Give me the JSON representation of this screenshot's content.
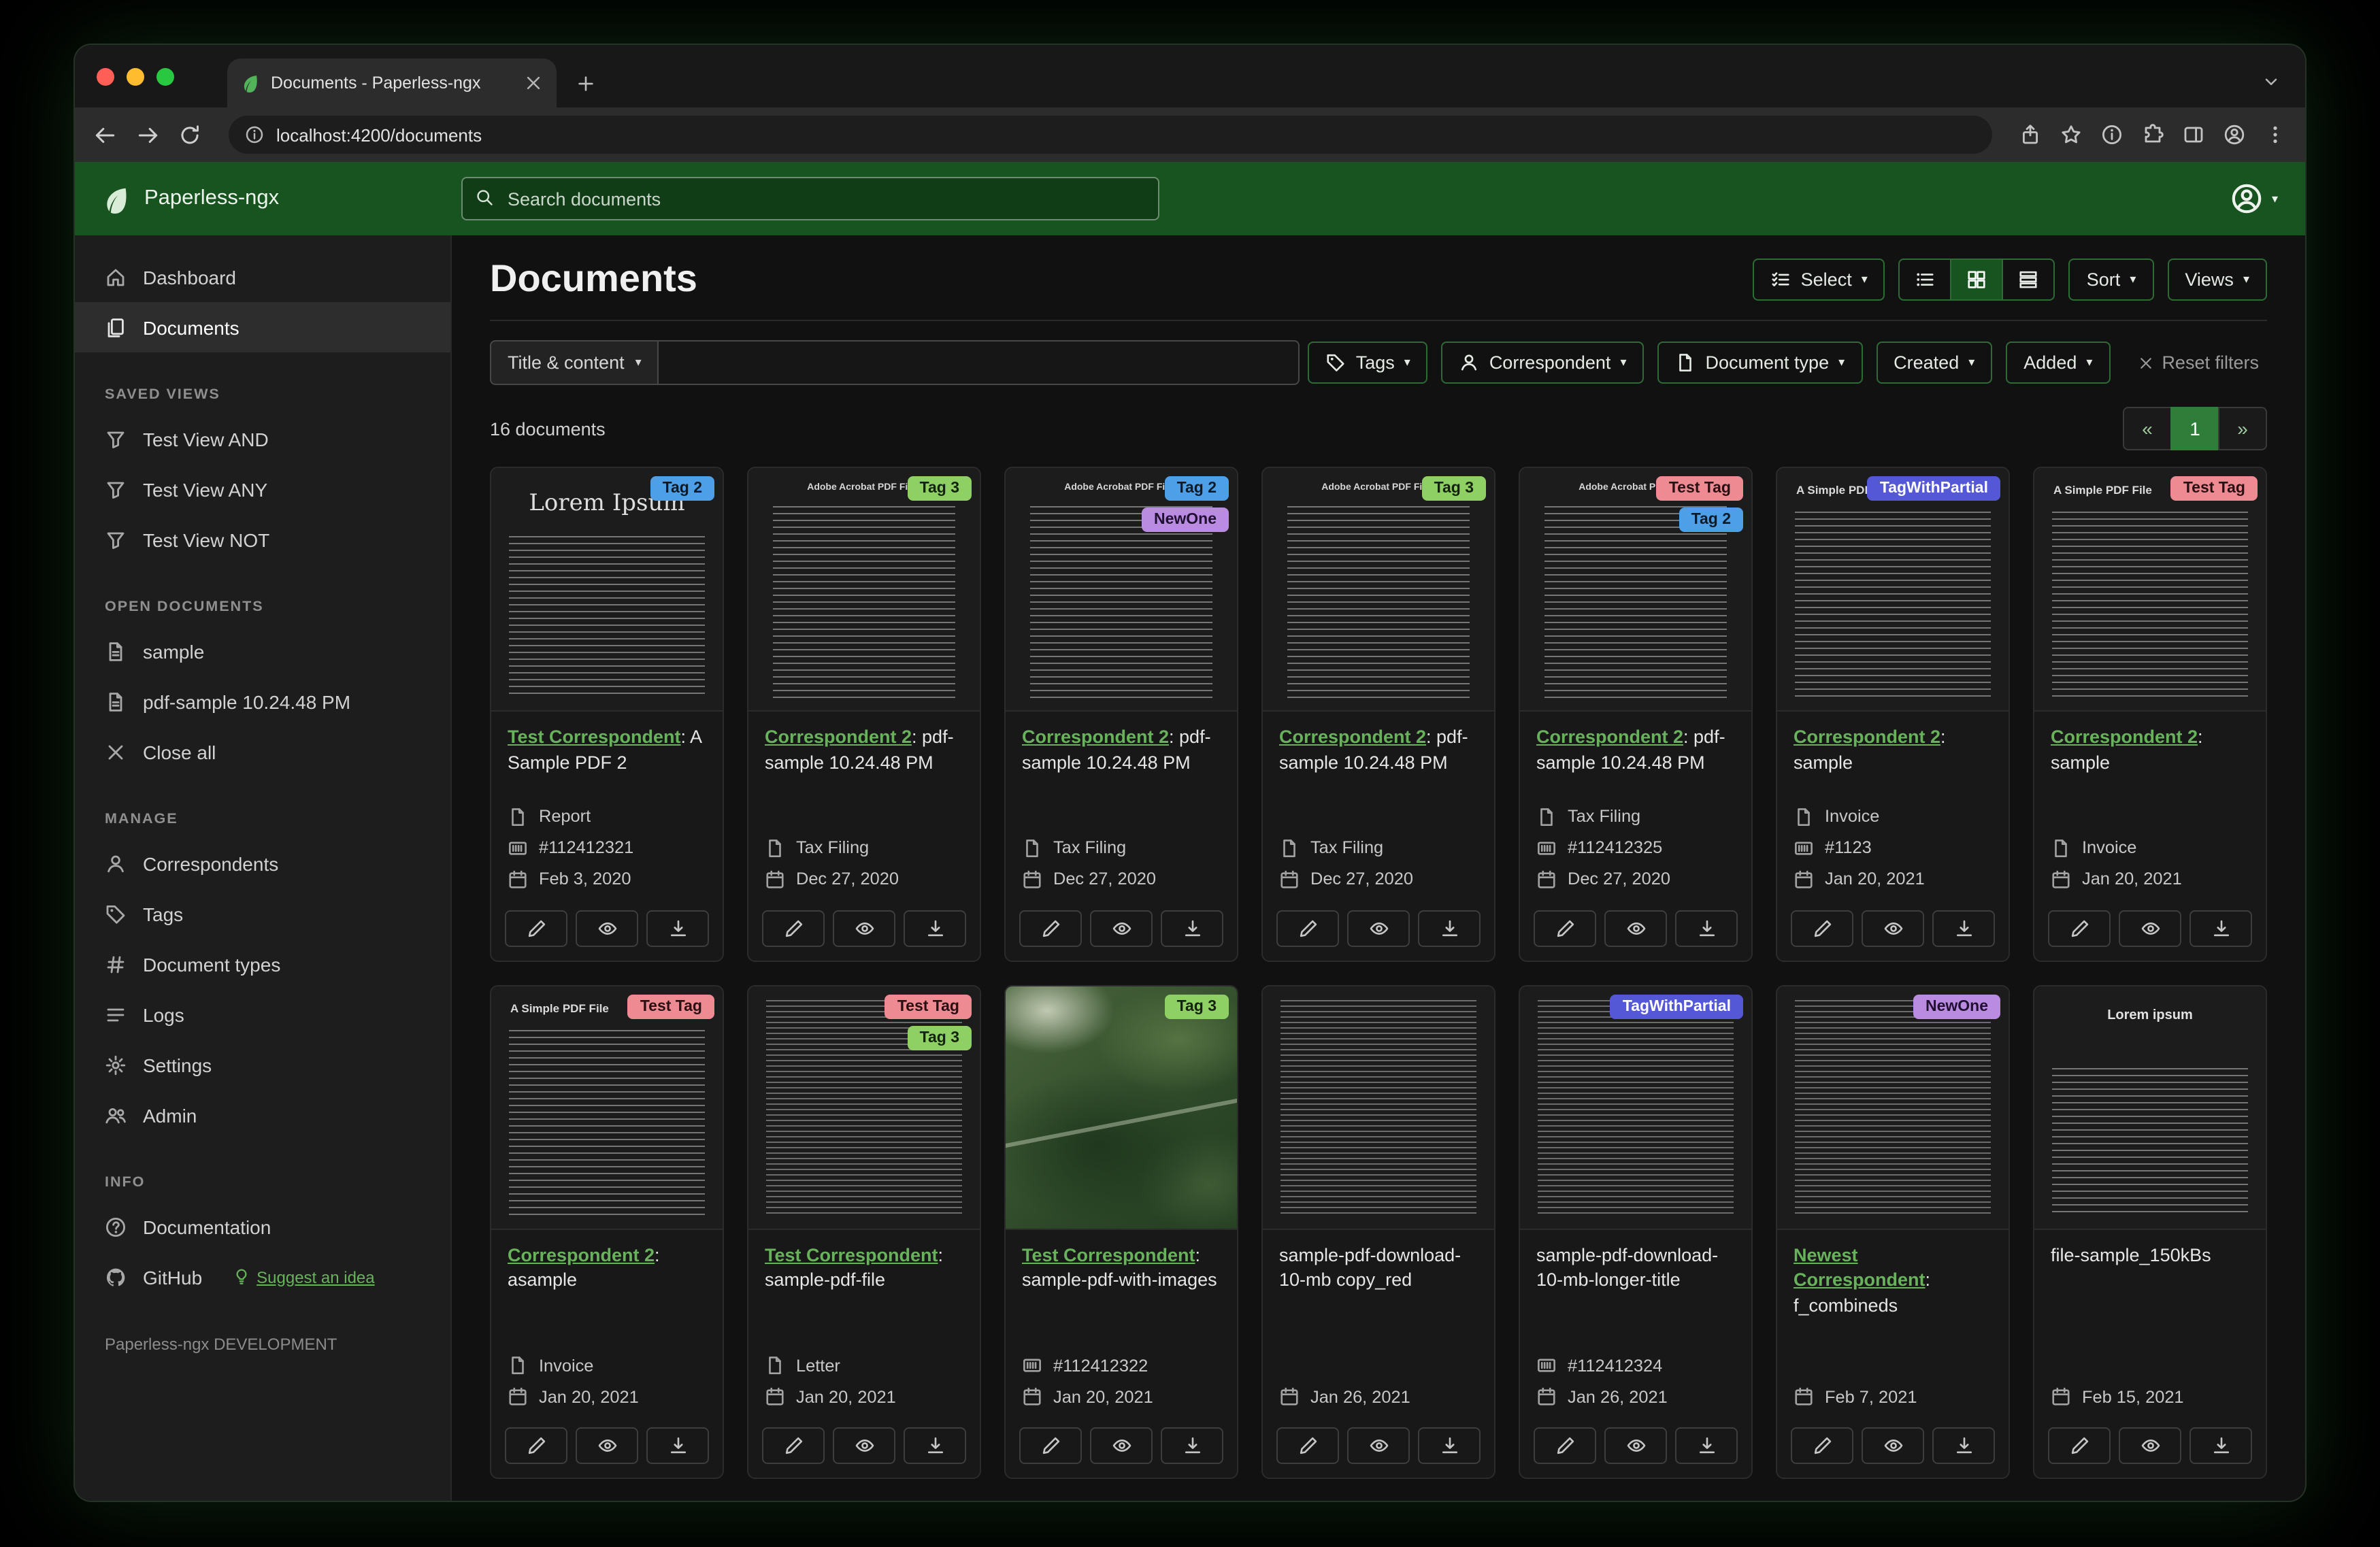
{
  "browser": {
    "tab_title": "Documents - Paperless-ngx",
    "url": "localhost:4200/documents"
  },
  "header": {
    "app_name": "Paperless-ngx",
    "search_placeholder": "Search documents"
  },
  "colors": {
    "header_green": "#17541f",
    "link_green": "#68b25c",
    "active_page_green": "#2f7d38",
    "tag_blue": "#4da0e8",
    "tag_green": "#8fd065",
    "tag_purple": "#b98ce2",
    "tag_pink": "#ee8a92",
    "tag_indigo": "#5558d6"
  },
  "sidebar": {
    "primary": [
      {
        "label": "Dashboard",
        "icon": "house-icon",
        "active": false
      },
      {
        "label": "Documents",
        "icon": "documents-icon",
        "active": true
      }
    ],
    "sections": [
      {
        "heading": "SAVED VIEWS",
        "items": [
          {
            "label": "Test View AND",
            "icon": "funnel-icon"
          },
          {
            "label": "Test View ANY",
            "icon": "funnel-icon"
          },
          {
            "label": "Test View NOT",
            "icon": "funnel-icon"
          }
        ]
      },
      {
        "heading": "OPEN DOCUMENTS",
        "items": [
          {
            "label": "sample",
            "icon": "file-text-icon"
          },
          {
            "label": "pdf-sample 10.24.48 PM",
            "icon": "file-text-icon"
          },
          {
            "label": "Close all",
            "icon": "close-icon"
          }
        ]
      },
      {
        "heading": "MANAGE",
        "items": [
          {
            "label": "Correspondents",
            "icon": "person-icon"
          },
          {
            "label": "Tags",
            "icon": "tag-icon"
          },
          {
            "label": "Document types",
            "icon": "hash-icon"
          },
          {
            "label": "Logs",
            "icon": "list-icon"
          },
          {
            "label": "Settings",
            "icon": "gear-icon"
          },
          {
            "label": "Admin",
            "icon": "people-icon"
          }
        ]
      },
      {
        "heading": "INFO",
        "items": [
          {
            "label": "Documentation",
            "icon": "question-circle-icon"
          },
          {
            "label": "GitHub",
            "icon": "github-icon",
            "extra": {
              "label": "Suggest an idea",
              "icon": "lightbulb-icon"
            }
          }
        ]
      }
    ],
    "footer": "Paperless-ngx DEVELOPMENT"
  },
  "main": {
    "title": "Documents",
    "count_text": "16 documents",
    "toolbar": {
      "select_label": "Select",
      "sort_label": "Sort",
      "views_label": "Views",
      "view_modes": [
        {
          "icon": "view-list-icon",
          "active": false
        },
        {
          "icon": "view-grid-icon",
          "active": true
        },
        {
          "icon": "view-details-icon",
          "active": false
        }
      ]
    },
    "filters": {
      "text_filter_label": "Title & content",
      "text_filter_value": "",
      "buttons": [
        {
          "label": "Tags",
          "icon": "tag-icon"
        },
        {
          "label": "Correspondent",
          "icon": "person-icon"
        },
        {
          "label": "Document type",
          "icon": "file-icon"
        },
        {
          "label": "Created",
          "icon": ""
        },
        {
          "label": "Added",
          "icon": ""
        }
      ],
      "reset_label": "Reset filters"
    },
    "pagination": {
      "prev": "«",
      "page": "1",
      "next": "»"
    },
    "documents": [
      {
        "thumb": {
          "kind": "lorem",
          "heading": "Lorem Ipsum"
        },
        "tags": [
          {
            "label": "Tag 2",
            "bg": "#4da0e8",
            "fg": "#0d1b28"
          }
        ],
        "correspondent": "Test Correspondent",
        "title_suffix": ": A Sample PDF 2",
        "doc_type": "Report",
        "asn": "#112412321",
        "date": "Feb 3, 2020"
      },
      {
        "thumb": {
          "kind": "acrobat",
          "heading": "Adobe Acrobat PDF Files"
        },
        "tags": [
          {
            "label": "Tag 3",
            "bg": "#8fd065",
            "fg": "#14230d"
          }
        ],
        "correspondent": "Correspondent 2",
        "title_suffix": ": pdf-sample 10.24.48 PM",
        "doc_type": "Tax Filing",
        "asn": null,
        "date": "Dec 27, 2020"
      },
      {
        "thumb": {
          "kind": "acrobat",
          "heading": "Adobe Acrobat PDF Files"
        },
        "tags": [
          {
            "label": "Tag 2",
            "bg": "#4da0e8",
            "fg": "#0d1b28"
          },
          {
            "label": "NewOne",
            "bg": "#b98ce2",
            "fg": "#201031"
          }
        ],
        "correspondent": "Correspondent 2",
        "title_suffix": ": pdf-sample 10.24.48 PM",
        "doc_type": "Tax Filing",
        "asn": null,
        "date": "Dec 27, 2020"
      },
      {
        "thumb": {
          "kind": "acrobat",
          "heading": "Adobe Acrobat PDF Files"
        },
        "tags": [
          {
            "label": "Tag 3",
            "bg": "#8fd065",
            "fg": "#14230d"
          }
        ],
        "correspondent": "Correspondent 2",
        "title_suffix": ": pdf-sample 10.24.48 PM",
        "doc_type": "Tax Filing",
        "asn": null,
        "date": "Dec 27, 2020"
      },
      {
        "thumb": {
          "kind": "acrobat",
          "heading": "Adobe Acrobat PDF Files"
        },
        "tags": [
          {
            "label": "Test Tag",
            "bg": "#ee8a92",
            "fg": "#2a1012"
          },
          {
            "label": "Tag 2",
            "bg": "#4da0e8",
            "fg": "#0d1b28"
          }
        ],
        "correspondent": "Correspondent 2",
        "title_suffix": ": pdf-sample 10.24.48 PM",
        "doc_type": "Tax Filing",
        "asn": "#112412325",
        "date": "Dec 27, 2020"
      },
      {
        "thumb": {
          "kind": "simple",
          "heading": "A Simple PDF File"
        },
        "tags": [
          {
            "label": "TagWithPartial",
            "bg": "#5558d6",
            "fg": "#ffffff"
          }
        ],
        "correspondent": "Correspondent 2",
        "title_suffix": ": sample",
        "doc_type": "Invoice",
        "asn": "#1123",
        "date": "Jan 20, 2021"
      },
      {
        "thumb": {
          "kind": "simple",
          "heading": "A Simple PDF File"
        },
        "tags": [
          {
            "label": "Test Tag",
            "bg": "#ee8a92",
            "fg": "#2a1012"
          }
        ],
        "correspondent": "Correspondent 2",
        "title_suffix": ": sample",
        "doc_type": "Invoice",
        "asn": null,
        "date": "Jan 20, 2021"
      },
      {
        "thumb": {
          "kind": "simple",
          "heading": "A Simple PDF File"
        },
        "tags": [
          {
            "label": "Test Tag",
            "bg": "#ee8a92",
            "fg": "#2a1012"
          }
        ],
        "correspondent": "Correspondent 2",
        "title_suffix": ": asample",
        "doc_type": "Invoice",
        "asn": null,
        "date": "Jan 20, 2021"
      },
      {
        "thumb": {
          "kind": "dense",
          "heading": ""
        },
        "tags": [
          {
            "label": "Test Tag",
            "bg": "#ee8a92",
            "fg": "#2a1012"
          },
          {
            "label": "Tag 3",
            "bg": "#8fd065",
            "fg": "#14230d"
          }
        ],
        "correspondent": "Test Correspondent",
        "title_suffix": ": sample-pdf-file",
        "doc_type": "Letter",
        "asn": null,
        "date": "Jan 20, 2021"
      },
      {
        "thumb": {
          "kind": "map",
          "heading": ""
        },
        "tags": [
          {
            "label": "Tag 3",
            "bg": "#8fd065",
            "fg": "#14230d"
          }
        ],
        "correspondent": "Test Correspondent",
        "title_suffix": ": sample-pdf-with-images",
        "doc_type": null,
        "asn": "#112412322",
        "date": "Jan 20, 2021"
      },
      {
        "thumb": {
          "kind": "dense",
          "heading": ""
        },
        "tags": [],
        "correspondent": null,
        "title_suffix": "sample-pdf-download-10-mb copy_red",
        "doc_type": null,
        "asn": null,
        "date": "Jan 26, 2021"
      },
      {
        "thumb": {
          "kind": "dense",
          "heading": ""
        },
        "tags": [
          {
            "label": "TagWithPartial",
            "bg": "#5558d6",
            "fg": "#ffffff"
          }
        ],
        "correspondent": null,
        "title_suffix": "sample-pdf-download-10-mb-longer-title",
        "doc_type": null,
        "asn": "#112412324",
        "date": "Jan 26, 2021"
      },
      {
        "thumb": {
          "kind": "dense",
          "heading": ""
        },
        "tags": [
          {
            "label": "NewOne",
            "bg": "#b98ce2",
            "fg": "#201031"
          }
        ],
        "correspondent": "Newest Correspondent",
        "title_suffix": ": f_combineds",
        "doc_type": null,
        "asn": null,
        "date": "Feb 7, 2021"
      },
      {
        "thumb": {
          "kind": "lorembold",
          "heading": "Lorem ipsum"
        },
        "tags": [],
        "correspondent": null,
        "title_suffix": "file-sample_150kBs",
        "doc_type": null,
        "asn": null,
        "date": "Feb 15, 2021"
      }
    ]
  }
}
